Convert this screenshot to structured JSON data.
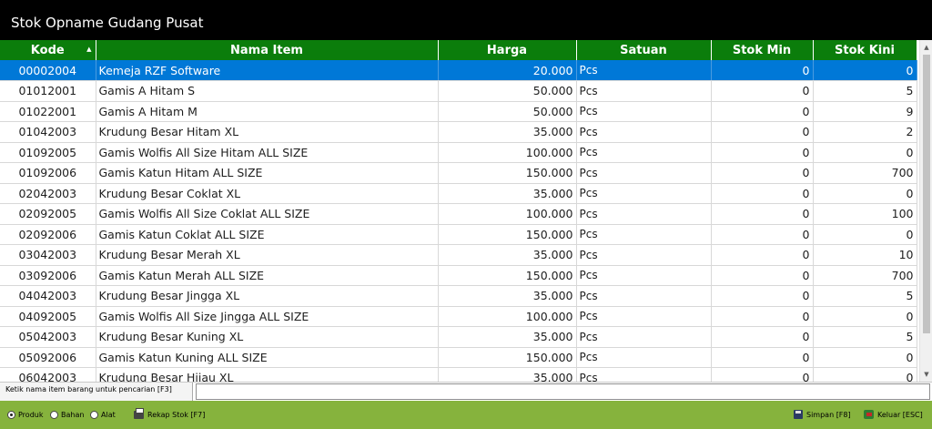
{
  "window": {
    "title": "Stok Opname Gudang Pusat"
  },
  "table": {
    "columns": [
      "Kode",
      "Nama Item",
      "Harga",
      "Satuan",
      "Stok Min",
      "Stok Kini"
    ],
    "selected_index": 0,
    "rows": [
      [
        "00002004",
        "Kemeja RZF Software",
        "20.000",
        "Pcs",
        "0",
        "0"
      ],
      [
        "01012001",
        "Gamis A Hitam S",
        "50.000",
        "Pcs",
        "0",
        "5"
      ],
      [
        "01022001",
        "Gamis A Hitam M",
        "50.000",
        "Pcs",
        "0",
        "9"
      ],
      [
        "01042003",
        "Krudung Besar Hitam XL",
        "35.000",
        "Pcs",
        "0",
        "2"
      ],
      [
        "01092005",
        "Gamis Wolfis All Size Hitam ALL SIZE",
        "100.000",
        "Pcs",
        "0",
        "0"
      ],
      [
        "01092006",
        "Gamis Katun  Hitam ALL SIZE",
        "150.000",
        "Pcs",
        "0",
        "700"
      ],
      [
        "02042003",
        "Krudung Besar Coklat XL",
        "35.000",
        "Pcs",
        "0",
        "0"
      ],
      [
        "02092005",
        "Gamis Wolfis All Size Coklat ALL SIZE",
        "100.000",
        "Pcs",
        "0",
        "100"
      ],
      [
        "02092006",
        "Gamis Katun  Coklat ALL SIZE",
        "150.000",
        "Pcs",
        "0",
        "0"
      ],
      [
        "03042003",
        "Krudung Besar Merah XL",
        "35.000",
        "Pcs",
        "0",
        "10"
      ],
      [
        "03092006",
        "Gamis Katun  Merah ALL SIZE",
        "150.000",
        "Pcs",
        "0",
        "700"
      ],
      [
        "04042003",
        "Krudung Besar Jingga XL",
        "35.000",
        "Pcs",
        "0",
        "5"
      ],
      [
        "04092005",
        "Gamis Wolfis All Size Jingga ALL SIZE",
        "100.000",
        "Pcs",
        "0",
        "0"
      ],
      [
        "05042003",
        "Krudung Besar Kuning XL",
        "35.000",
        "Pcs",
        "0",
        "5"
      ],
      [
        "05092006",
        "Gamis Katun  Kuning ALL SIZE",
        "150.000",
        "Pcs",
        "0",
        "0"
      ],
      [
        "06042003",
        "Krudung Besar Hijau XL",
        "35.000",
        "Pcs",
        "0",
        "0"
      ]
    ]
  },
  "search": {
    "label": "Ketik nama item barang untuk pencarian [F3]",
    "value": ""
  },
  "footer": {
    "radios": [
      {
        "label": "Produk",
        "checked": true
      },
      {
        "label": "Bahan",
        "checked": false
      },
      {
        "label": "Alat",
        "checked": false
      }
    ],
    "rekap_label": "Rekap Stok [F7]",
    "simpan_label": "Simpan [F8]",
    "keluar_label": "Keluar [ESC]"
  },
  "colors": {
    "titlebar": "#000000",
    "header": "#0b7d0b",
    "selected_row": "#0078d7",
    "footer": "#86b33d"
  }
}
